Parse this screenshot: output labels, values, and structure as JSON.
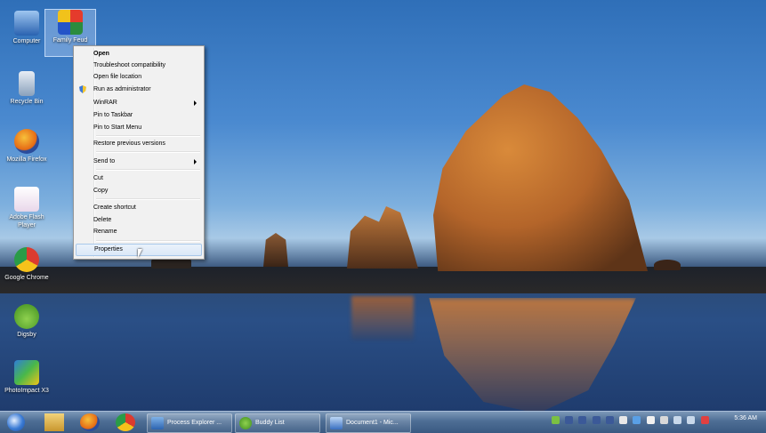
{
  "desktop": {
    "icons": [
      {
        "label": "Computer"
      },
      {
        "label": "Family Feud"
      },
      {
        "label": "Recycle Bin"
      },
      {
        "label": "Mozilla Firefox"
      },
      {
        "label": "Adobe Flash Player"
      },
      {
        "label": "Google Chrome"
      },
      {
        "label": "Digsby"
      },
      {
        "label": "PhotoImpact X3"
      }
    ]
  },
  "context_menu": {
    "items": [
      {
        "label": "Open"
      },
      {
        "label": "Troubleshoot compatibility"
      },
      {
        "label": "Open file location"
      },
      {
        "label": "Run as administrator"
      },
      {
        "label": "WinRAR"
      },
      {
        "label": "Pin to Taskbar"
      },
      {
        "label": "Pin to Start Menu"
      },
      {
        "label": "Restore previous versions"
      },
      {
        "label": "Send to"
      },
      {
        "label": "Cut"
      },
      {
        "label": "Copy"
      },
      {
        "label": "Create shortcut"
      },
      {
        "label": "Delete"
      },
      {
        "label": "Rename"
      },
      {
        "label": "Properties"
      }
    ]
  },
  "taskbar": {
    "windows": [
      {
        "label": "Process Explorer ..."
      },
      {
        "label": "Buddy List"
      },
      {
        "label": "Document1 - Mic..."
      }
    ],
    "clock": {
      "time": "5:36 AM"
    }
  },
  "colors": {
    "menu_bg": "#f1f1f1",
    "menu_hover": "#dbe8f7",
    "taskbar": "#4d6d94"
  }
}
